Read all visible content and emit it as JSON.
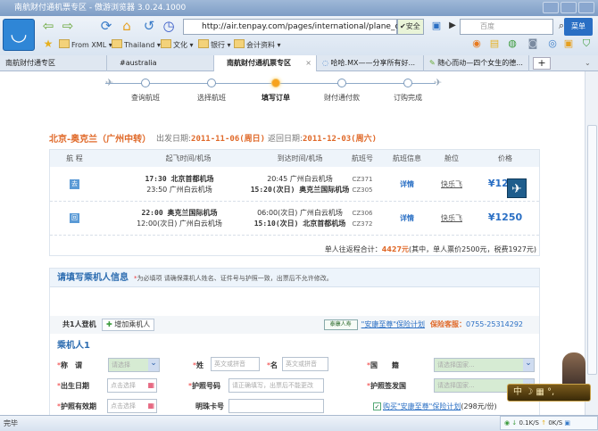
{
  "window": {
    "title": "南航财付通机票专区 - 傲游浏览器 3.0.24.1000"
  },
  "toolbar": {
    "url": "http://air.tenpay.com/pages/international/plane_c",
    "safe": "安全",
    "search_placeholder": "百度",
    "menu": "菜单"
  },
  "bookmarks": [
    "From XML ▾",
    "Thailand ▾",
    "文化 ▾",
    "银行 ▾",
    "会计资料 ▾"
  ],
  "tabs": [
    {
      "label": "南航财付通专区"
    },
    {
      "label": "#australia"
    },
    {
      "label": "南航财付通机票专区",
      "active": true
    },
    {
      "label": "哈哈.MX——分享所有好..."
    },
    {
      "label": "随心而动—四个女生的德..."
    }
  ],
  "steps": {
    "items": [
      "查询航班",
      "选择航班",
      "填写订单",
      "财付通付款",
      "订购完成"
    ],
    "current": 2
  },
  "trip": {
    "route": "北京-奥克兰（广州中转）",
    "depart_label": "出发日期:",
    "depart": "2011-11-06(周日)",
    "return_label": "返回日期:",
    "return": "2011-12-03(周六)"
  },
  "table": {
    "headers": [
      "航 程",
      "起飞时间/机场",
      "到达时间/机场",
      "航班号",
      "航班信息",
      "舱位",
      "价格"
    ],
    "rows": [
      {
        "leg": "去",
        "dep1": "17:30 北京首都机场",
        "dep2": "23:50 广州白云机场",
        "arr1": "20:45 广州白云机场",
        "arr2": "15:20(次日) 奥克兰国际机场",
        "fn1": "CZ371",
        "fn2": "CZ305",
        "info": "详情",
        "cabin": "快乐飞",
        "price": "¥1250"
      },
      {
        "leg": "回",
        "dep1": "22:00 奥克兰国际机场",
        "dep2": "12:00(次日) 广州白云机场",
        "arr1": "06:00(次日) 广州白云机场",
        "arr2": "15:10(次日) 北京首都机场",
        "fn1": "CZ306",
        "fn2": "CZ372",
        "info": "详情",
        "cabin": "快乐飞",
        "price": "¥1250"
      }
    ],
    "total_label": "单人往返程合计：",
    "total": "4427元",
    "total_detail": "(其中，单人票价2500元，税费1927元)"
  },
  "passenger": {
    "title": "请填写乘机人信息",
    "note_star": "*",
    "note": "为必填项 请确保乘机人姓名、证件号与护照一致，出票后不允许修改。",
    "count": "共1人登机",
    "add": "增加乘机人",
    "insurer_logo": "泰康人寿",
    "plan": "\"安康至尊\"保险计划",
    "service_label": "保险客服：",
    "service_phone": "0755-25314292",
    "person": "乘机人1",
    "fields": {
      "title": "称　谓",
      "title_val": "请选择",
      "surname": "姓",
      "surname_ph": "英文或拼音",
      "given": "名",
      "given_ph": "英文或拼音",
      "nation": "国　　籍",
      "nation_val": "请选择国家...",
      "birth": "出生日期",
      "birth_ph": "点击选择",
      "passport": "护照号码",
      "passport_ph": "请正确填写，出票后不能更改",
      "issuer": "护照签发国",
      "issuer_val": "请选择国家...",
      "expiry": "护照有效期",
      "expiry_ph": "点击选择",
      "card": "明珠卡号",
      "buy": "购买\"安康至尊\"保险计划",
      "buy_price": "(298元/份)"
    }
  },
  "status": {
    "text": "完毕",
    "down": "0.1K/S",
    "up": "0K/S"
  },
  "widget": {
    "text": "中 ☽ ▦ °,"
  }
}
